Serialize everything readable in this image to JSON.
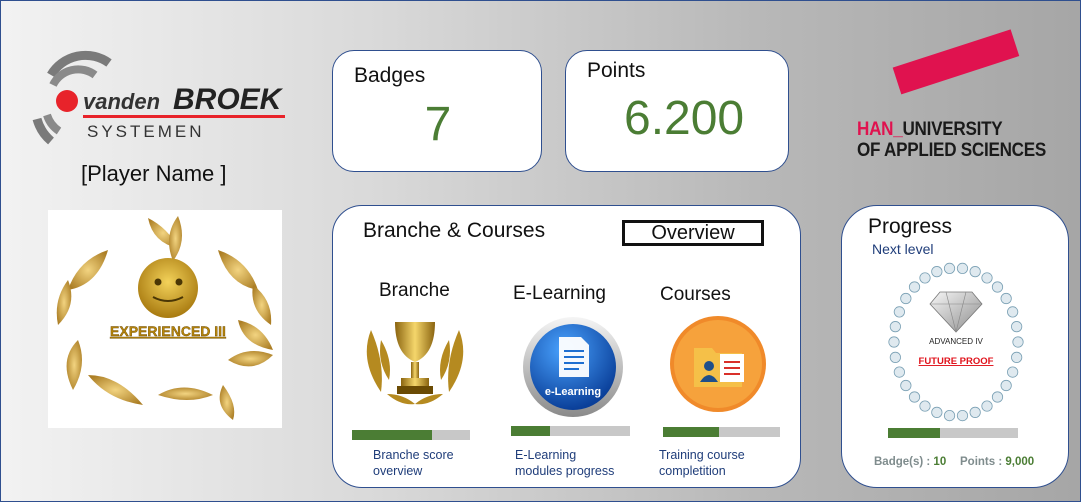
{
  "company_logo": {
    "brand_prefix": "vanden",
    "brand_main": "BROEK",
    "brand_sub": "SYSTEMEN"
  },
  "player": {
    "name": "[Player Name ]",
    "rank_label": "EXPERIENCED III"
  },
  "badges_card": {
    "label": "Badges",
    "value": "7"
  },
  "points_card": {
    "label": "Points",
    "value": "6.200"
  },
  "university_logo": {
    "line1_accent": "HAN_",
    "line1_rest": "UNIVERSITY",
    "line2": "OF APPLIED SCIENCES"
  },
  "branche_courses": {
    "title": "Branche & Courses",
    "overview_button": "Overview",
    "items": [
      {
        "label": "Branche",
        "caption_line1": "Branche score",
        "caption_line2": "overview",
        "progress": 0.68,
        "icon": "trophy-icon"
      },
      {
        "label": "E-Learning",
        "caption_line1": "E-Learning",
        "caption_line2": "modules progress",
        "progress": 0.33,
        "icon": "elearning-icon",
        "icon_text": "e-Learning"
      },
      {
        "label": "Courses",
        "caption_line1": "Training course",
        "caption_line2": "completition",
        "progress": 0.48,
        "icon": "course-folder-icon"
      }
    ]
  },
  "progress_card": {
    "title": "Progress",
    "next_level_label": "Next level",
    "level_name": "ADVANCED IV",
    "level_motto": "FUTURE PROOF",
    "progress": 0.4,
    "badges_label": "Badge(s) : ",
    "badges_value": "10",
    "points_label": "Points : ",
    "points_value": "9,000"
  },
  "colors": {
    "accent_green": "#4b7d34",
    "card_border": "#2f4f8f",
    "han_red": "#e0124f",
    "vdb_red": "#e8232a",
    "gold": "#c9a227"
  }
}
